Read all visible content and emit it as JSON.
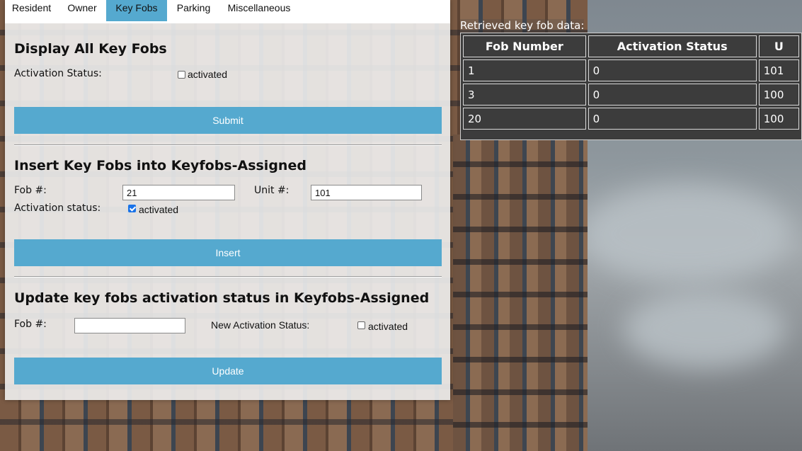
{
  "tabs": [
    "Resident",
    "Owner",
    "Key Fobs",
    "Parking",
    "Miscellaneous"
  ],
  "active_tab": "Key Fobs",
  "display_section": {
    "title": "Display All Key Fobs",
    "activation_label": "Activation Status:",
    "checkbox_label": "activated",
    "checkbox_checked": false,
    "button_label": "Submit"
  },
  "insert_section": {
    "title": "Insert Key Fobs into Keyfobs-Assigned",
    "fob_label": "Fob #:",
    "fob_value": "21",
    "unit_label": "Unit #:",
    "unit_value": "101",
    "activation_label": "Activation status:",
    "checkbox_label": "activated",
    "checkbox_checked": true,
    "button_label": "Insert"
  },
  "update_section": {
    "title": "Update key fobs activation status in Keyfobs-Assigned",
    "fob_label": "Fob #:",
    "fob_value": "",
    "new_status_label": "New Activation Status:",
    "checkbox_label": "activated",
    "checkbox_checked": false,
    "button_label": "Update"
  },
  "results": {
    "title": "Retrieved key fob data:",
    "columns": [
      "Fob Number",
      "Activation Status",
      "U"
    ],
    "rows": [
      [
        "1",
        "0",
        "101"
      ],
      [
        "3",
        "0",
        "100"
      ],
      [
        "20",
        "0",
        "100"
      ]
    ]
  },
  "colors": {
    "accent": "#55a9cf",
    "panel_bg": "#f0f0f0",
    "table_bg": "#3c3c3c",
    "checkbox_checked": "#1a73e8"
  }
}
